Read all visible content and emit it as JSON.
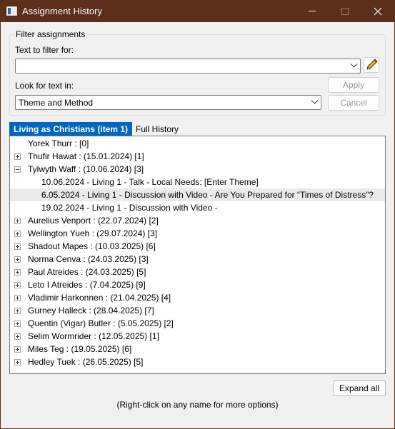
{
  "window": {
    "title": "Assignment History"
  },
  "filter": {
    "group_label": "Filter assignments",
    "text_label": "Text to filter for:",
    "text_value": "",
    "look_label": "Look for text in:",
    "look_value": "Theme and Method",
    "apply_label": "Apply",
    "cancel_label": "Cancel"
  },
  "tabs": [
    {
      "label": "Living as Christians (item 1)",
      "active": true
    },
    {
      "label": "Full History",
      "active": false
    }
  ],
  "tree": [
    {
      "text": "Yorek Thurr : [0]",
      "expander": "none"
    },
    {
      "text": "Thufir Hawat : (15.01.2024) [1]",
      "expander": "plus"
    },
    {
      "text": "Tylwyth Waff : (10.06.2024) [3]",
      "expander": "minus"
    },
    {
      "text": "10.06.2024 - Living 1 - Talk - Local Needs: [Enter Theme]",
      "expander": "child"
    },
    {
      "text": "6.05.2024 - Living 1 - Discussion with Video - Are You Prepared for “Times of Distress”?",
      "expander": "child",
      "selected": true
    },
    {
      "text": "19.02.2024 - Living 1 - Discussion with Video -",
      "expander": "child"
    },
    {
      "text": "Aurelius Venport : (22.07.2024) [2]",
      "expander": "plus"
    },
    {
      "text": "Wellington Yueh : (29.07.2024) [3]",
      "expander": "plus"
    },
    {
      "text": "Shadout Mapes : (10.03.2025) [6]",
      "expander": "plus"
    },
    {
      "text": "Norma Cenva : (24.03.2025) [3]",
      "expander": "plus"
    },
    {
      "text": "Paul Atreides : (24.03.2025) [5]",
      "expander": "plus"
    },
    {
      "text": "Leto I Atreides : (7.04.2025) [9]",
      "expander": "plus"
    },
    {
      "text": "Vladimir Harkonnen : (21.04.2025) [4]",
      "expander": "plus"
    },
    {
      "text": "Gurney Halleck : (28.04.2025) [7]",
      "expander": "plus"
    },
    {
      "text": "Quentin (Vigar) Butler : (5.05.2025) [2]",
      "expander": "plus"
    },
    {
      "text": "Selim Wormrider : (12.05.2025) [1]",
      "expander": "plus"
    },
    {
      "text": "Miles Teg : (19.05.2025) [6]",
      "expander": "plus"
    },
    {
      "text": "Hedley Tuek : (26.05.2025) [5]",
      "expander": "plus"
    }
  ],
  "footer": {
    "expand_all_label": "Expand all",
    "hint": "(Right-click on any name for more options)"
  },
  "icons": {
    "app": "app-icon",
    "minimize": "minimize-icon",
    "maximize": "maximize-icon",
    "close": "close-icon",
    "edit": "pencil-icon",
    "dropdown": "chevron-down-icon"
  },
  "colors": {
    "titlebar": "#5b2f1a",
    "active_tab": "#0067c0",
    "selected_row": "#eaeaea"
  }
}
